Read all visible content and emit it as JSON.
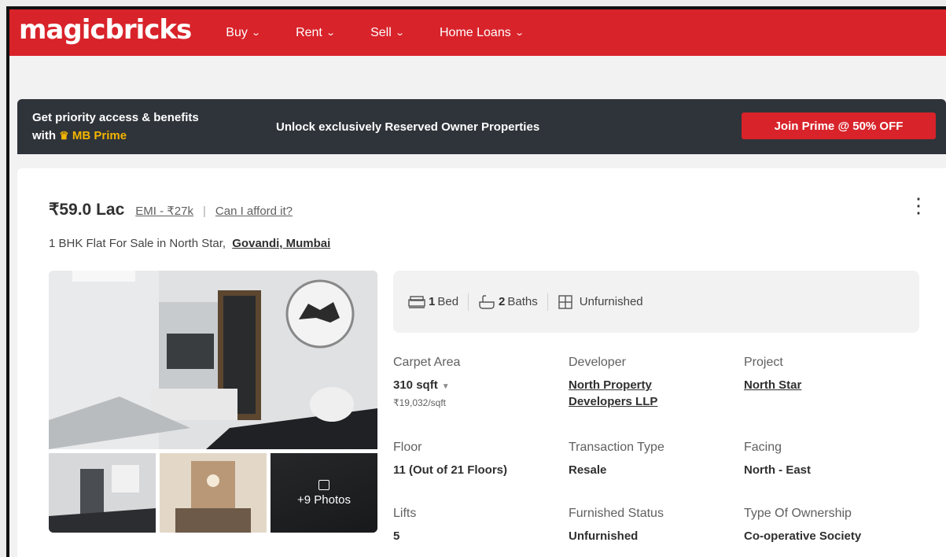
{
  "header": {
    "logo": "magicbricks",
    "nav": [
      {
        "label": "Buy"
      },
      {
        "label": "Rent"
      },
      {
        "label": "Sell"
      },
      {
        "label": "Home Loans"
      }
    ]
  },
  "prime_banner": {
    "line1": "Get priority access & benefits",
    "line2_prefix": "with",
    "brand": "MB Prime",
    "message": "Unlock exclusively Reserved Owner Properties",
    "cta": "Join Prime @ 50% OFF"
  },
  "listing": {
    "price": "₹59.0 Lac",
    "emi": "EMI - ₹27k",
    "separator": "|",
    "afford": "Can I afford it?",
    "title": "1 BHK Flat For Sale in North Star,",
    "locality": "Govandi, Mumbai",
    "photos_more": "+9 Photos",
    "summary": {
      "beds_num": "1",
      "beds_label": "Bed",
      "baths_num": "2",
      "baths_label": "Baths",
      "furnishing": "Unfurnished"
    },
    "details": {
      "carpet_area": {
        "label": "Carpet Area",
        "value": "310 sqft",
        "sub": "₹19,032/sqft"
      },
      "developer": {
        "label": "Developer",
        "value_line1": "North Property",
        "value_line2": "Developers LLP"
      },
      "project": {
        "label": "Project",
        "value": "North Star"
      },
      "floor": {
        "label": "Floor",
        "value": "11 (Out of 21 Floors)"
      },
      "transaction": {
        "label": "Transaction Type",
        "value": "Resale"
      },
      "facing": {
        "label": "Facing",
        "value": "North - East"
      },
      "lifts": {
        "label": "Lifts",
        "value": "5"
      },
      "furnished": {
        "label": "Furnished Status",
        "value": "Unfurnished"
      },
      "ownership": {
        "label": "Type Of Ownership",
        "value": "Co-operative Society"
      }
    }
  },
  "colors": {
    "brand_red": "#d8232a",
    "banner_dark": "#2f343a",
    "prime_gold": "#f4b400"
  }
}
